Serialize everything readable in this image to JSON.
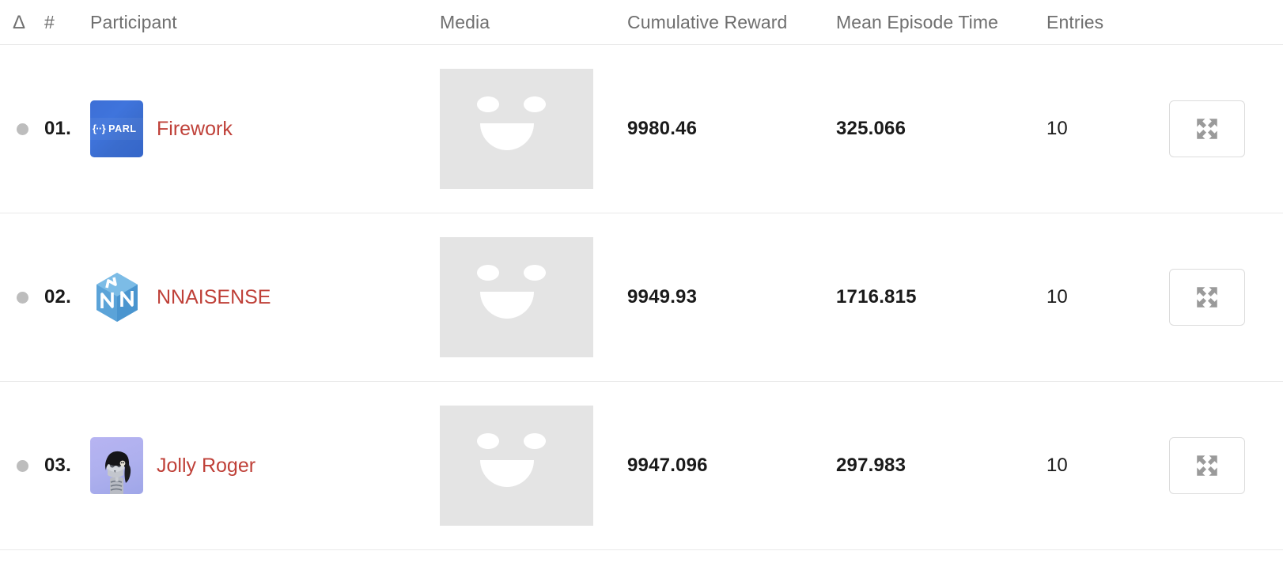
{
  "table": {
    "columns": [
      {
        "key": "delta",
        "label": "Δ",
        "icon": "delta-icon"
      },
      {
        "key": "rank",
        "label": "#"
      },
      {
        "key": "participant",
        "label": "Participant"
      },
      {
        "key": "media",
        "label": "Media"
      },
      {
        "key": "reward",
        "label": "Cumulative Reward"
      },
      {
        "key": "time",
        "label": "Mean Episode Time"
      },
      {
        "key": "entries",
        "label": "Entries"
      }
    ],
    "header": {
      "delta": "Δ",
      "rank": "#",
      "participant": "Participant",
      "media": "Media",
      "reward": "Cumulative Reward",
      "time": "Mean Episode Time",
      "entries": "Entries"
    },
    "rows": [
      {
        "rank": "01.",
        "participant": "Firework",
        "logo_name": "parl-logo",
        "logo_text": "PARL",
        "logo_brackets": "{··}",
        "media_alt": "smiley-placeholder",
        "reward": "9980.46",
        "time": "325.066",
        "entries": "10",
        "action_label": "expand-icon"
      },
      {
        "rank": "02.",
        "participant": "NNAISENSE",
        "logo_name": "nnaisense-logo",
        "logo_text": "",
        "logo_brackets": "",
        "media_alt": "smiley-placeholder",
        "reward": "9949.93",
        "time": "1716.815",
        "entries": "10",
        "action_label": "expand-icon"
      },
      {
        "rank": "03.",
        "participant": "Jolly Roger",
        "logo_name": "jolly-roger-logo",
        "logo_text": "",
        "logo_brackets": "",
        "media_alt": "smiley-placeholder",
        "reward": "9947.096",
        "time": "297.983",
        "entries": "10",
        "action_label": "expand-icon"
      }
    ]
  },
  "colors": {
    "participant_link": "#bf4038",
    "header_text": "#6f6f6f",
    "value_text": "#1a1a1a",
    "status_dot": "#bdbdbd",
    "media_placeholder": "#e4e4e4",
    "divider": "#e9e9e9",
    "parl_logo_bg": "#3f74dc",
    "jolly_logo_bg": "#aeb0ee"
  }
}
